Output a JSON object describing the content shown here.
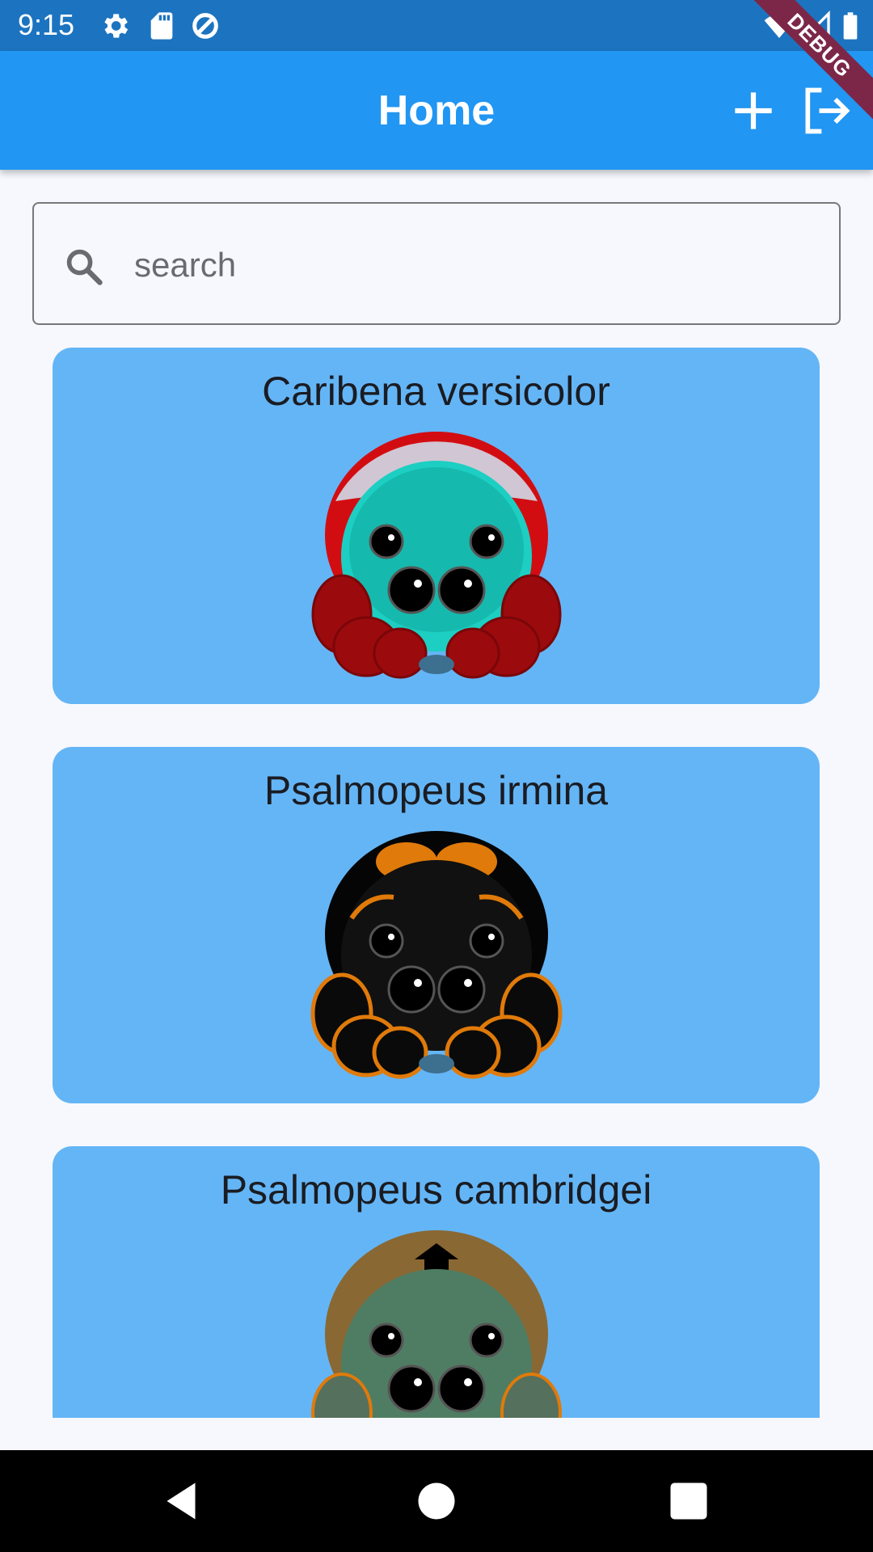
{
  "status_bar": {
    "time": "9:15",
    "icons": [
      "gear-icon",
      "sd-card-icon",
      "data-saver-icon"
    ],
    "right_icons": [
      "wifi-icon",
      "signal-icon",
      "battery-icon"
    ]
  },
  "debug_banner": "DEBUG",
  "app_bar": {
    "title": "Home",
    "actions": [
      "add-icon",
      "logout-icon"
    ]
  },
  "search": {
    "placeholder": "search",
    "value": ""
  },
  "species": [
    {
      "name": "Caribena versicolor",
      "colors": {
        "carapace_ring": "#d20d12",
        "carapace_top": "#d1c6d3",
        "body": "#1ccfc2",
        "legs": "#9b0a0d"
      }
    },
    {
      "name": "Psalmopeus irmina",
      "colors": {
        "carapace_ring": "#050505",
        "carapace_top": "#e07a0a",
        "body": "#111111",
        "legs": "#0a0a0a",
        "leg_accent": "#e07a0a"
      }
    },
    {
      "name": "Psalmopeus cambridgei",
      "colors": {
        "carapace_ring": "#8a6833",
        "carapace_top": "#000000",
        "body": "#4f7d63",
        "legs": "#55705d",
        "leg_accent": "#e07a0a"
      }
    }
  ],
  "nav_bar": [
    "back-icon",
    "home-icon",
    "recents-icon"
  ],
  "theme": {
    "primary": "#2196f3",
    "status_bar": "#1c74c0",
    "card": "#64b5f6",
    "background": "#f6f8fd"
  }
}
